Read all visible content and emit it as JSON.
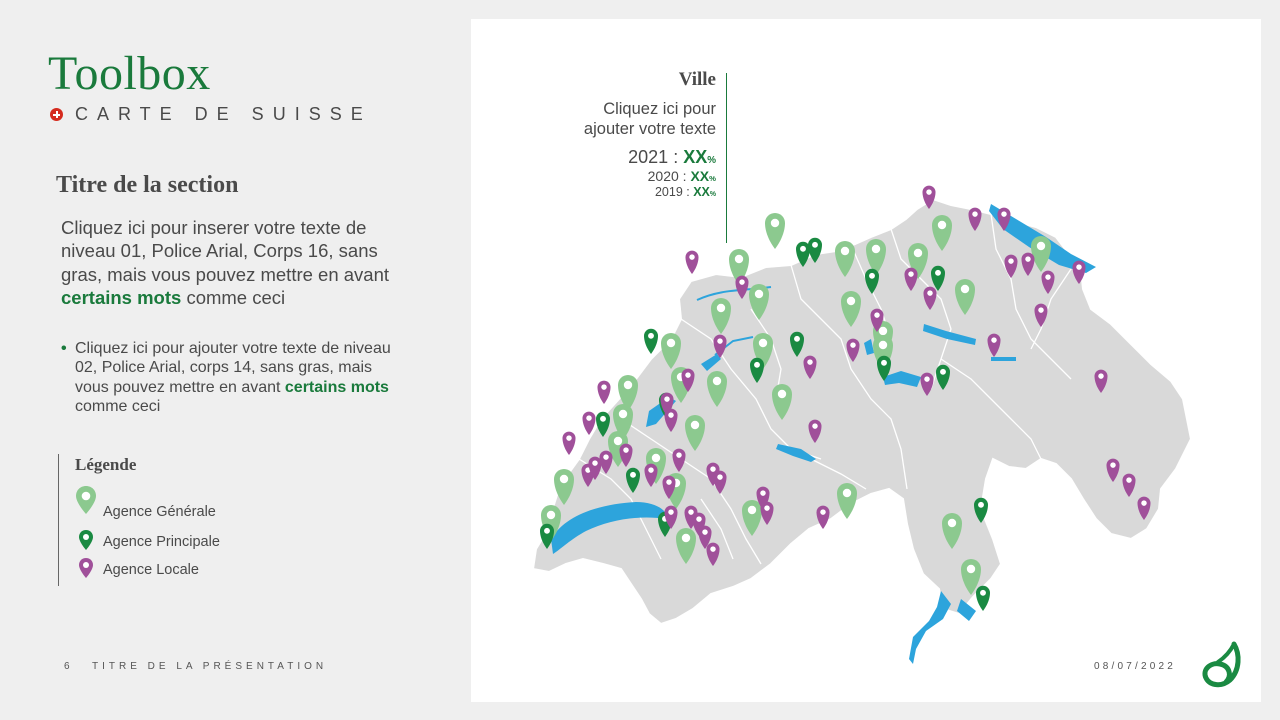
{
  "header": {
    "title": "Toolbox",
    "subtitle": "CARTE DE SUISSE"
  },
  "section": {
    "title": "Titre de la section",
    "body_before": "Cliquez ici pour inserer votre texte de niveau 01, Police Arial, Corps 16, sans gras, mais vous pouvez mettre en avant",
    "body_highlight": "certains mots",
    "body_after": "comme ceci",
    "bullet_before": "Cliquez ici pour ajouter votre texte de niveau 02, Police Arial, corps 14, sans gras, mais vous pouvez mettre en avant",
    "bullet_highlight": "certains mots",
    "bullet_after": "comme ceci"
  },
  "legend": {
    "title": "Légende",
    "items": [
      {
        "label": "Agence Générale",
        "color": "#8cc98f"
      },
      {
        "label": "Agence Principale",
        "color": "#1a8a42"
      },
      {
        "label": "Agence Locale",
        "color": "#a0509a"
      }
    ]
  },
  "info_box": {
    "title": "Ville",
    "text_line1": "Cliquez ici pour",
    "text_line2": "ajouter votre texte",
    "stats": [
      {
        "year": "2021",
        "value": "XX",
        "unit": "%"
      },
      {
        "year": "2020",
        "value": "XX",
        "unit": "%"
      },
      {
        "year": "2019",
        "value": "XX",
        "unit": "%"
      }
    ]
  },
  "footer": {
    "page": "6",
    "title": "TITRE DE LA PRÉSENTATION",
    "date": "08/07/2022"
  },
  "colors": {
    "brand_green": "#1a7a3c",
    "map_fill": "#d9d9d9",
    "water": "#2da4dc",
    "swiss_red": "#d52b1e"
  }
}
